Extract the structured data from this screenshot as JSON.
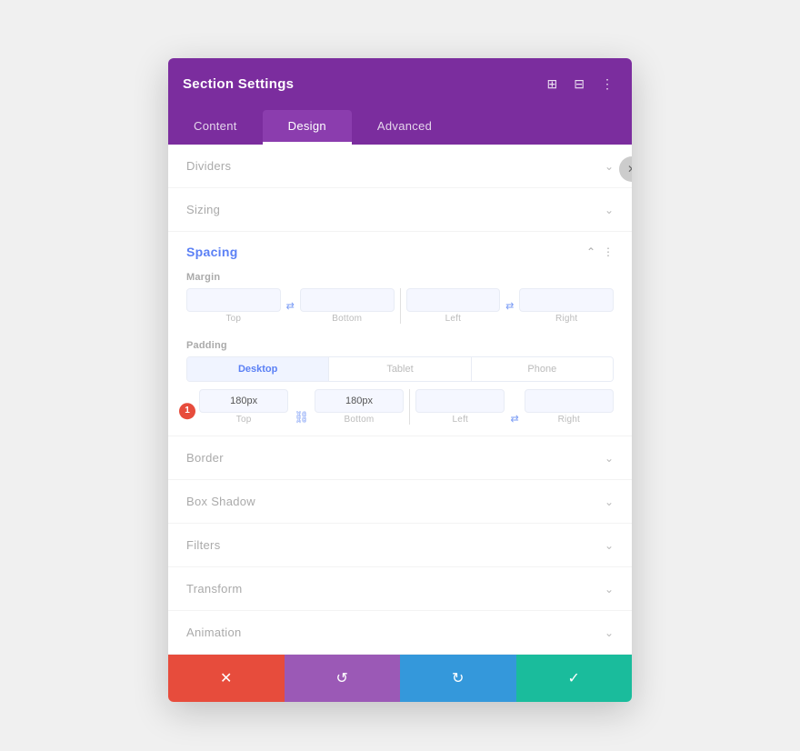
{
  "header": {
    "title": "Section Settings",
    "icons": [
      "fullscreen",
      "split",
      "more"
    ]
  },
  "tabs": [
    {
      "id": "content",
      "label": "Content",
      "active": false
    },
    {
      "id": "design",
      "label": "Design",
      "active": true
    },
    {
      "id": "advanced",
      "label": "Advanced",
      "active": false
    }
  ],
  "sections": [
    {
      "id": "dividers",
      "label": "Dividers",
      "expanded": false
    },
    {
      "id": "sizing",
      "label": "Sizing",
      "expanded": false
    }
  ],
  "spacing": {
    "title": "Spacing",
    "expanded": true,
    "margin": {
      "label": "Margin",
      "top": {
        "value": "",
        "placeholder": ""
      },
      "bottom": {
        "value": "",
        "placeholder": ""
      },
      "left": {
        "value": "",
        "placeholder": ""
      },
      "right": {
        "value": "",
        "placeholder": ""
      }
    },
    "padding": {
      "label": "Padding",
      "devices": [
        "Desktop",
        "Tablet",
        "Phone"
      ],
      "active_device": "Desktop",
      "top": {
        "value": "180px",
        "placeholder": ""
      },
      "bottom": {
        "value": "180px",
        "placeholder": ""
      },
      "left": {
        "value": "",
        "placeholder": ""
      },
      "right": {
        "value": "",
        "placeholder": ""
      }
    }
  },
  "lower_sections": [
    {
      "id": "border",
      "label": "Border",
      "expanded": false
    },
    {
      "id": "box-shadow",
      "label": "Box Shadow",
      "expanded": false
    },
    {
      "id": "filters",
      "label": "Filters",
      "expanded": false
    },
    {
      "id": "transform",
      "label": "Transform",
      "expanded": false
    },
    {
      "id": "animation",
      "label": "Animation",
      "expanded": false
    }
  ],
  "footer": {
    "cancel_label": "✕",
    "undo_label": "↺",
    "redo_label": "↻",
    "save_label": "✓"
  },
  "step_badge": "1"
}
